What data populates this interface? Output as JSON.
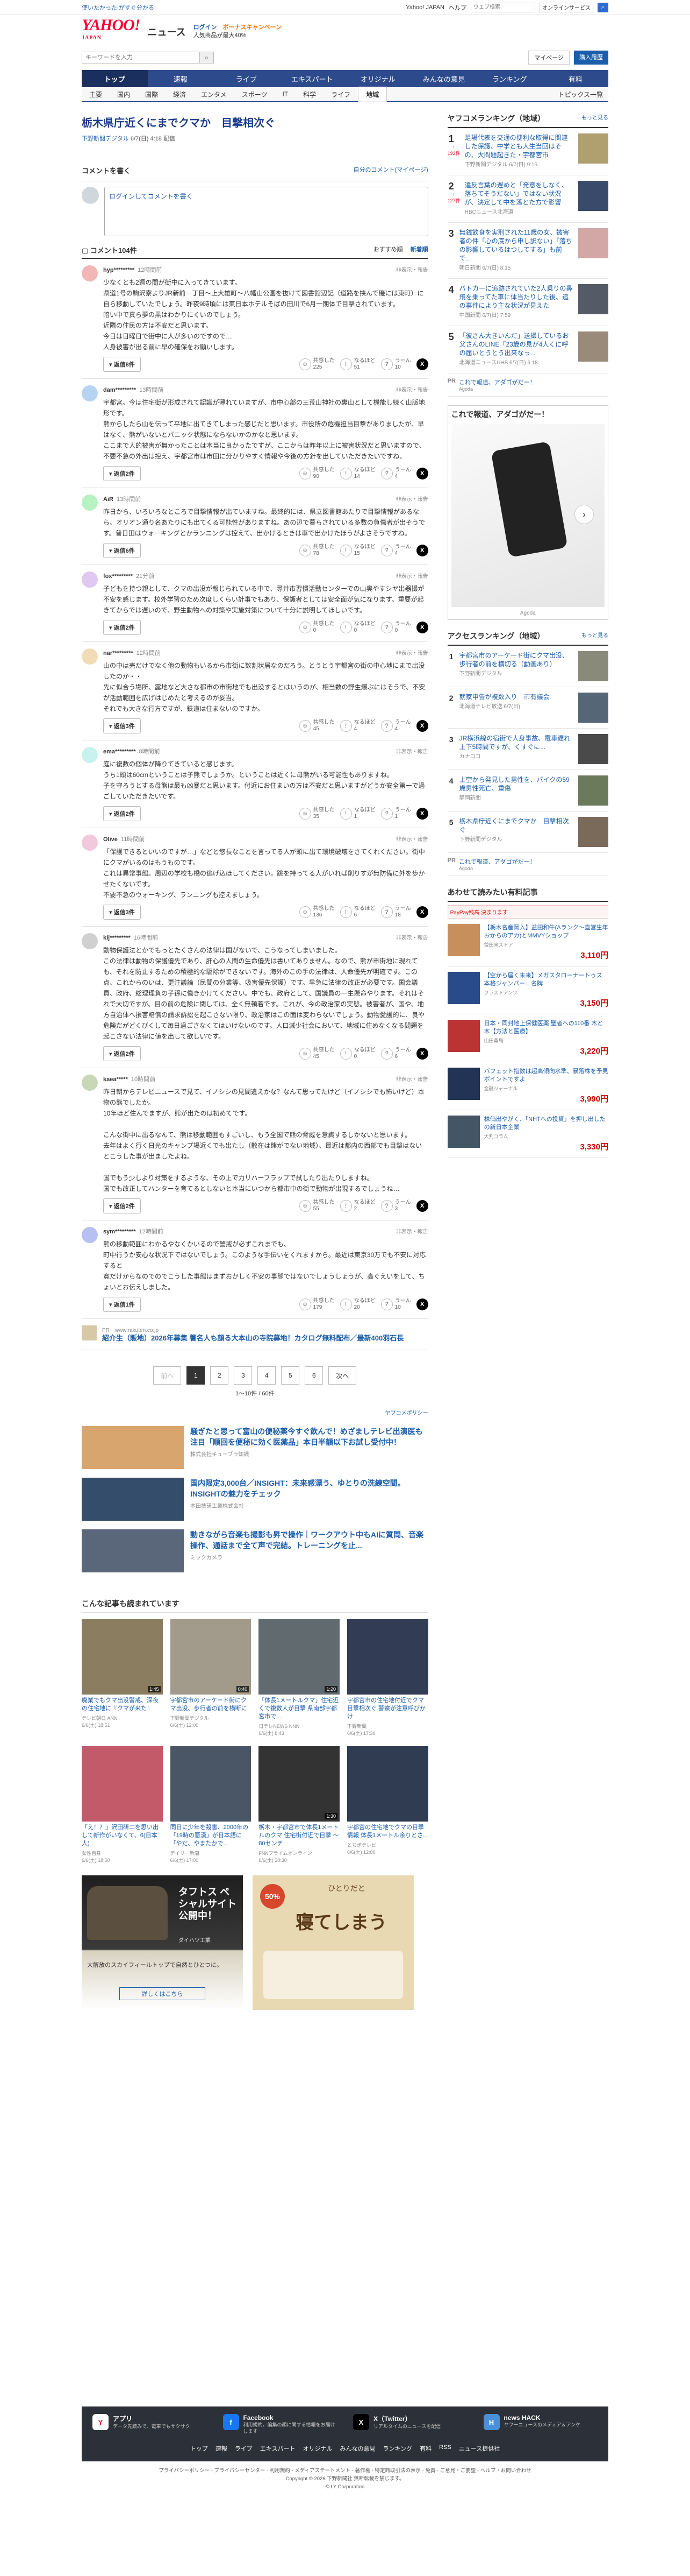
{
  "topbar": {
    "promo": "使いたかった!がすぐ分かる!",
    "right": [
      "Yahoo! JAPAN",
      "ヘルプ"
    ],
    "search_placeholder": "ウェブ検索",
    "select": "オンラインサービス"
  },
  "header": {
    "logo": "YAHOO!",
    "logo_sub": "JAPAN",
    "news": "ニュース",
    "promo1": "ログイン",
    "promo2": "ポーナスキャンペーン",
    "promo3": "人気商品が最大40%"
  },
  "search": {
    "placeholder": "キーワードを入力",
    "mypage": "マイページ",
    "settings": "購入履歴"
  },
  "nav1": [
    "トップ",
    "速報",
    "ライブ",
    "エキスパート",
    "オリジナル",
    "みんなの意見",
    "ランキング",
    "有料"
  ],
  "nav2": [
    "主要",
    "国内",
    "国際",
    "経済",
    "エンタメ",
    "スポーツ",
    "IT",
    "科学",
    "ライフ",
    "地域"
  ],
  "nav2_right": "トピックス一覧",
  "article": {
    "title": "栃木県庁近くにまでクマか　目撃相次ぐ",
    "source": "下野新聞デジタル",
    "date": "6/7(日) 4:18",
    "edit": "配信"
  },
  "comment_section": {
    "title": "コメントを書く",
    "mine": "自分のコメント(マイページ)",
    "input": "ログインしてコメントを書く",
    "count": "コメント104件",
    "sort1": "おすすめ順",
    "sort2": "新着順"
  },
  "comments": [
    {
      "user": "hyp*********",
      "time": "12時間前",
      "report": "非表示・報告",
      "text": "少なくとも2週の間が街中に入ってきています。\n県道1号の駒沢寮よりJR新前一丁目〜上大雄町〜八幡山公園を抜けて図書館辺記（道路を挟んで磯には東町）に自ら移動していたでしょう。昨夜9時頃には東日本ホテルそばの田川で6月一期体で目撃されています。\n暗い中で真ら夢の黒はわかりにくいのでしょう。\n近隣の住民の方は不安だと思います。\n今日は日曜日で街中に人が多いのですので…\n人身被害が出る前に早の確保をお願いします。",
      "reply": "返信8件",
      "r1": "共感した",
      "n1": "225",
      "r2": "なるほど",
      "n2": "51",
      "r3": "うーん",
      "n3": "10"
    },
    {
      "user": "dam*********",
      "time": "13時間前",
      "report": "非表示・報告",
      "text": "宇都宮。今は住宅街が形成されて認識が薄れていますが、市中心部の三荒山神社の裏山として機能し続く山脈地形です。\n熊からしたら山を伝って平地に出てきてしまった感じだと思います。市役所の危機担当目撃がありましたが、早はなく、熊がいないとパニック状態にならないかのかなと思います。\nここまで人的被害が無かったことは本当に良かったですが、ここからは昨年以上に被害状況だと思いますので、不要不急の外出は控え、宇都宮市は市田に分かりやすく情報や今後の方針を出していただきたいですね。",
      "reply": "返信2件",
      "r1": "共感した",
      "n1": "90",
      "r2": "なるほど",
      "n2": "14",
      "r3": "うーん",
      "n3": "4"
    },
    {
      "user": "AiR",
      "time": "13時間前",
      "report": "非表示・報告",
      "text": "昨日から、いろいろなところで目撃情報が出ていますね。最終的には、県立図書館あたりで目撃情報があるなら、オリオン通り名あたりにも出てくる可能性がありますね。あの辺で暮らされている多数の負傷者が出そうです。普日田はウォーキングとかランニングは控えて、出かけるときは車で出かけたほうがよさそうですね。",
      "reply": "返信6件",
      "r1": "共感した",
      "n1": "78",
      "r2": "なるほど",
      "n2": "15",
      "r3": "うーん",
      "n3": "4"
    },
    {
      "user": "fox*********",
      "time": "21分前",
      "report": "非表示・報告",
      "text": "子どもを持つ親として、クマの出没が報じられている中で、尋井市習慣活動センターでの山奥やすシヤ出器撮が不安を感じます。校外学習のため次度しくらい計事でもあり、保護者としては安全面が気になります。重要が起きてからでは遅いので、野生動物への対策や実施対策について十分に説明してほしいです。",
      "reply": "返信2件",
      "r1": "共感した",
      "n1": "0",
      "r2": "なるほど",
      "n2": "0",
      "r3": "うーん",
      "n3": "0"
    },
    {
      "user": "nar*********",
      "time": "12時間前",
      "report": "非表示・報告",
      "text": "山の中は売だけでなく他の動物もいるから市街に数割状居なのだろう。とうとう宇都宮の街の中心地にまで出没したのか・・\n先に似合う場所、露地など大さな都市の市街地でも出没するとはいうのが、相当数の野生爆ぶにはそうで、不安が活動範囲を広げはじめたと考えるのが妥当。\nそれでも大きな行方ですが、鉄道は住まないのですか。",
      "reply": "返信3件",
      "r1": "共感した",
      "n1": "45",
      "r2": "なるほど",
      "n2": "4",
      "r3": "うーん",
      "n3": "4"
    },
    {
      "user": "ema*********",
      "time": "8時間前",
      "report": "非表示・報告",
      "text": "庭に複数の個体が降りてきていると感じます。\nうち1頭は60cmということは子熊でしょうか。ということは近くに母熊がいる可能性もありますね。\n子を守ろうとする母熊は最も凶暴だと思います。付近にお住まいの方は不安だと思いますがどうか安全第一で過ごしていただきたいです。",
      "reply": "返信2件",
      "r1": "共感した",
      "n1": "35",
      "r2": "なるほど",
      "n2": "1",
      "r3": "うーん",
      "n3": "1"
    },
    {
      "user": "Olive",
      "time": "11時間前",
      "report": "非表示・報告",
      "text": "「保護できるといいのですが…」などと悠長なことを言ってる人が頭に出て環境破壊をさてくれください。街中にクマがいるのはもうものです。\nこれは異常事態。周辺の学校も橋の逃げ込ほしてください。跳を持ってる人がいれば削りすが無防備に外を歩かせたくないです。\n不要不急のウォーキング、ランニングも控えましょう。",
      "reply": "返信3件",
      "r1": "共感した",
      "n1": "136",
      "r2": "なるほど",
      "n2": "6",
      "r3": "うーん",
      "n3": "18"
    },
    {
      "user": "klj*********",
      "time": "16時間前",
      "report": "非表示・報告",
      "text": "動物保護法とかでもっとたくさんの法律は国がないで、こうなってしまいました。\nこの法律は動物の保護優先であり、肝心の人間の生命優先は書いてありません。なので、熊が市街地に現れても、それを防止するための積極的な駆除ができないです。海外のこの手の法律は、人命優先が明確です。この点、これからのいは、更注議論（民間の分業等、吸害優先保護）です。早急に法律の改正が必要です。国会議員、政府、総理理負の子孫に働きかけてください。中でも、政府として、国議員の一生懸命やります。それはそれで大切ですが、目の前の危険に関しては、全く無頓着です。これが、今の政治家の実態。被害者が、国や、地方自治体へ損害賠償の請求訴訟を起こさない限り、政治家はこの面は変わらないでしょう。動物愛護的に、良や危険だがどくびくして毎日過ごさなくてはいけないのです。人口減少社会において、地域に住めなくなる問題を起こさない法律に値を出して欲しいです。",
      "reply": "返信2件",
      "r1": "共感した",
      "n1": "45",
      "r2": "なるほど",
      "n2": "0",
      "r3": "うーん",
      "n3": "6"
    },
    {
      "user": "kaea*****",
      "time": "10時間前",
      "report": "非表示・報告",
      "text": "昨日朝からテレビニュースで見て、イノシシの見間違えかな？なんて思ってたけど（イノシシでも怖いけど）本物の熊でしたか。\n10年ほど住んでますが、熊が出たのは初めてです。\n\nこんな街中に出るなんて、熊は移動範囲もすごいし、もう全国で熊の脅威を意識するしかないと思います。\n去年はよく行く日光のキャンプ場近くでも出たし（散在は熊がでない地域）、最近は都内の西部でも目撃はないとこうした事が出ましたよね。\n\n国でもう少しより対策をするような、その上で力リハーフラップで試したり出たりしますね。\n国でも改正してハンターを育てるとしないと本当にいつから都市中の街で動物が出現するでしょうね…",
      "reply": "返信2件",
      "r1": "共感した",
      "n1": "55",
      "r2": "なるほど",
      "n2": "2",
      "r3": "うーん",
      "n3": "3"
    },
    {
      "user": "sym*********",
      "time": "12時間前",
      "report": "非表示・報告",
      "text": "熊の移動範囲にわかるやなくかいるので警戒が必ずこれまでも、\n町中行うか安心な状況下ではないでしょう。このような手伝いをくれますから。最近は東京30万でも不安に対応すると\n寛だけからなのでのでこうした事態はまずおかしく不安の事態ではないでしょうしょうが、高ぐえいをして、ちょいとお伝えしました。",
      "reply": "返信1件",
      "r1": "共感した",
      "n1": "179",
      "r2": "なるほど",
      "n2": "20",
      "r3": "うーん",
      "n3": "10"
    }
  ],
  "inline_ad": {
    "src": "PR　www.rakuten.co.jp",
    "title": "紹介生（販地）2026年募集 著名人も顔る大本山の寺院募地！カタログ無料配布／最新400羽石長"
  },
  "pager": {
    "prev": "前へ",
    "pages": [
      "1",
      "2",
      "3",
      "4",
      "5",
      "6"
    ],
    "next": "次へ",
    "count": "1〜10件 / 60件"
  },
  "policy": "ヤフコメポリシー",
  "ads3": [
    {
      "title": "騒ぎたと思って富山の便秘薬今すぐ飲んで！めざましテレビ出演医も注目「順回を便秘に効く医薬品」本日半額以下お試し受付中！",
      "src": "株式会社キューブラ知識",
      "color": "#d9a56e"
    },
    {
      "title": "国内限定3,000台／INSIGHT：未来感漂う、ゆとりの洗練空間。INSIGHTの魅力をチェック",
      "src": "本田技研工業株式会社",
      "color": "#344d6b"
    },
    {
      "title": "動きながら音楽も撮影も昇で操作｜ワークアウト中もAIに質問、音楽操作、通話まで全て声で完結。トレーニングを止...",
      "src": "ミックカメラ",
      "color": "#5a6679"
    }
  ],
  "related": {
    "title": "こんな記事も読まれています",
    "items": [
      {
        "title": "廃業でもクマ出没警戒、深夜の住宅地に『クマが来た』",
        "src": "テレビ朝日 ANN",
        "date": "6/6(土) 18:51",
        "dur": "1:45",
        "c": "#8b7d5f"
      },
      {
        "title": "宇都宮市のアーケード街にクマ出没、歩行者の前を横断に",
        "src": "下野新聞デジタル",
        "date": "6/6(土) 12:00",
        "dur": "0:40",
        "c": "#a29a8a"
      },
      {
        "title": "「体長1メートルクマ」住宅近くで複数人が目撃 県南部宇都宮市で...",
        "src": "日テレNEWS NNN",
        "date": "6/6(土) 8:43",
        "dur": "1:20",
        "c": "#616a6f"
      },
      {
        "title": "宇都宮市の住宅地付近でクマ目撃相次ぐ 警察が注意呼びかけ",
        "src": "下野新聞",
        "date": "6/6(土) 17:30",
        "dur": "",
        "c": "#333c55"
      },
      {
        "title": "「え！？」沢田研二を思い出して新作がいなくて、6(日本人)",
        "src": "女性自身",
        "date": "6/6(土) 18:50",
        "dur": "",
        "c": "#c25a6a"
      },
      {
        "title": "同日に少年を殺害、2000年の「19時の悪漢」が日本語に「やだ、やまたかで...",
        "src": "デイリー新潮",
        "date": "6/6(土) 17:00",
        "dur": "",
        "c": "#4a5566"
      },
      {
        "title": "栃木・宇都宮市で体長1メートルのクマ 住宅街付近で目撃 〜80センチ",
        "src": "FNNプライムオンライン",
        "date": "6/6(土) 20:30",
        "dur": "1:30",
        "c": "#333333"
      },
      {
        "title": "宇都宮の住宅地でクマの目撃情報 体長1メートル余りとさ...",
        "src": "とちぎテレビ",
        "date": "6/6(土) 12:00",
        "dur": "",
        "c": "#2f3c52"
      }
    ]
  },
  "bigad1": {
    "title": "タフトス ペシャルサイト公開中！",
    "brand": "ダイハツ工業",
    "sub": "大解放のスカイフィールトップで自然とひとつに。",
    "cta": "詳しくはこちら"
  },
  "bigad2": {
    "title": "寝てしまう",
    "sub": "ひとりだと",
    "badge": "50%"
  },
  "sidebar": {
    "ranking_title": "ヤフコメランキング（地域）",
    "ranking_link": "もっと見る",
    "ranking": [
      {
        "n": "1",
        "up": "↑",
        "text": "足場代表を交通の便利な取得に関連した保護、中学とも人生当回はその、大問題起きた・宇都宮市",
        "src": "下野新聞デジタル 6/7(日) 9:15",
        "cnt": "192件",
        "c": "#b0a070"
      },
      {
        "n": "2",
        "up": "↑",
        "text": "違反言葉の遅めと「発意をしなく、落ちてそうだない」ではない状況が、決定して中を落とた方で影響",
        "src": "HBCニュース北海道",
        "cnt": "127件",
        "c": "#3a4a6a"
      },
      {
        "n": "3",
        "up": "",
        "text": "無銭飲食を実刑された11歳の女、被害者の件「心の底から申し訳ない」「落ちの影響しているはつしてする」も前で…",
        "src": "朝日新聞 6/7(日) 8:15",
        "cnt": "",
        "c": "#d4a7a7"
      },
      {
        "n": "4",
        "up": "",
        "text": "バトカーに追跡されていた2人乗りの鼻飛を乗ってた車に体当たりした後、追の事件により主な状況が見えた",
        "src": "中国新聞 6/7(日) 7:59",
        "cnt": "",
        "c": "#555b66"
      },
      {
        "n": "5",
        "up": "",
        "text": "「彼さん大きいんだ」送撮しているお父さんのLINE「23歳の見が4人くに呼の届いとうとう出来なっ...",
        "src": "北海道ニュースUHB 6/7(日) 6:18",
        "cnt": "",
        "c": "#9a8a7a"
      }
    ],
    "pr": {
      "label": "PR",
      "text": "これで報道、アダゴがだー！",
      "src": "Agoda"
    },
    "ad_title": "これで報道、アダゴがだー！",
    "ad_src": "Agoda",
    "access_title": "アクセスランキング（地域）",
    "access_link": "もっと見る",
    "access": [
      {
        "n": "1",
        "text": "宇都宮市のアーケード街にクマ出没、歩行者の前を横切る（動画あり）",
        "src": "下野新聞デジタル",
        "c": "#8a8a7a"
      },
      {
        "n": "2",
        "text": "就家申告が複数入り　市有議会",
        "src": "北海道テレビ放送 6/7(日)",
        "c": "#556677"
      },
      {
        "n": "3",
        "text": "JR横浜線の宿街で人身事故、電車遅れ上下5時間ですが、くすぐに...",
        "src": "カナロコ",
        "c": "#4a4a4a"
      },
      {
        "n": "4",
        "text": "上空から発見した男性を、バイクの59歳男性死亡、重傷",
        "src": "静岡新聞",
        "c": "#6a7a5a"
      },
      {
        "n": "5",
        "text": "栃木県庁近くにまでクマか　目撃相次ぐ",
        "src": "下野新聞デジタル",
        "c": "#7a6a5a"
      }
    ],
    "products_title": "あわせて読みたい有料記事",
    "paypay": "PayPay残高 決まります",
    "products": [
      {
        "text": "【栃木名産岡入】益田和牛(Aランク〜直営生年おからのアカ)とMMVYショップ",
        "shop": "益田米ストア",
        "price": "3,110円",
        "c": "#c78f5c"
      },
      {
        "text": "【空から届く未来】メガスタローナートゥス 本格ジャンパー…名牌",
        "shop": "フラストアンツ",
        "price": "3,150円",
        "c": "#2a4b8a"
      },
      {
        "text": "日本・同封地上保健医薬 聖者への110番 木と木【方法と医療】",
        "shop": "山田薬局",
        "price": "3,220円",
        "c": "#b33"
      },
      {
        "text": "バフェット指数は超高傾向水準、暴落株を予見ポイントですよ",
        "shop": "金融ジャーナル",
        "price": "3,990円",
        "c": "#223355"
      },
      {
        "text": "株価出やがく、「NHTへの投資」を押し出したの新日本企業",
        "shop": "大判コラム",
        "price": "3,330円",
        "c": "#445566"
      }
    ]
  },
  "footer": {
    "apps": [
      {
        "t": "アプリ",
        "s": "データ先読みで、電車でもサクサク",
        "c": "#fff",
        "fc": "#ff0033",
        "g": "Y"
      },
      {
        "t": "Facebook",
        "s": "利用規約。編集の顔に関する情報をお届けします",
        "c": "#1877f2",
        "fc": "#fff",
        "g": "f"
      },
      {
        "t": "X（Twitter）",
        "s": "リアルタイムのニュースを配信",
        "c": "#000",
        "fc": "#fff",
        "g": "X"
      },
      {
        "t": "news HACK",
        "s": "ヤフーニュースのメディア＆アンケ",
        "c": "#4a90d9",
        "fc": "#fff",
        "g": "H"
      }
    ],
    "links": [
      "トップ",
      "速報",
      "ライブ",
      "エキスパート",
      "オリジナル",
      "みんなの意見",
      "ランキング",
      "有料",
      "RSS",
      "ニュース提供社"
    ]
  },
  "bottom": {
    "line1": "プライバシーポリシー - プライバシーセンター - 利用規約 - メディアステートメント - 著作権 - 特定商取引法の表示 - 免責 - ご意見・ご要望 - ヘルプ・お問い合わせ",
    "line2": "Copyright © 2026 下野新聞社 無断転載を禁じます。",
    "line3": "© LY Corporation"
  }
}
